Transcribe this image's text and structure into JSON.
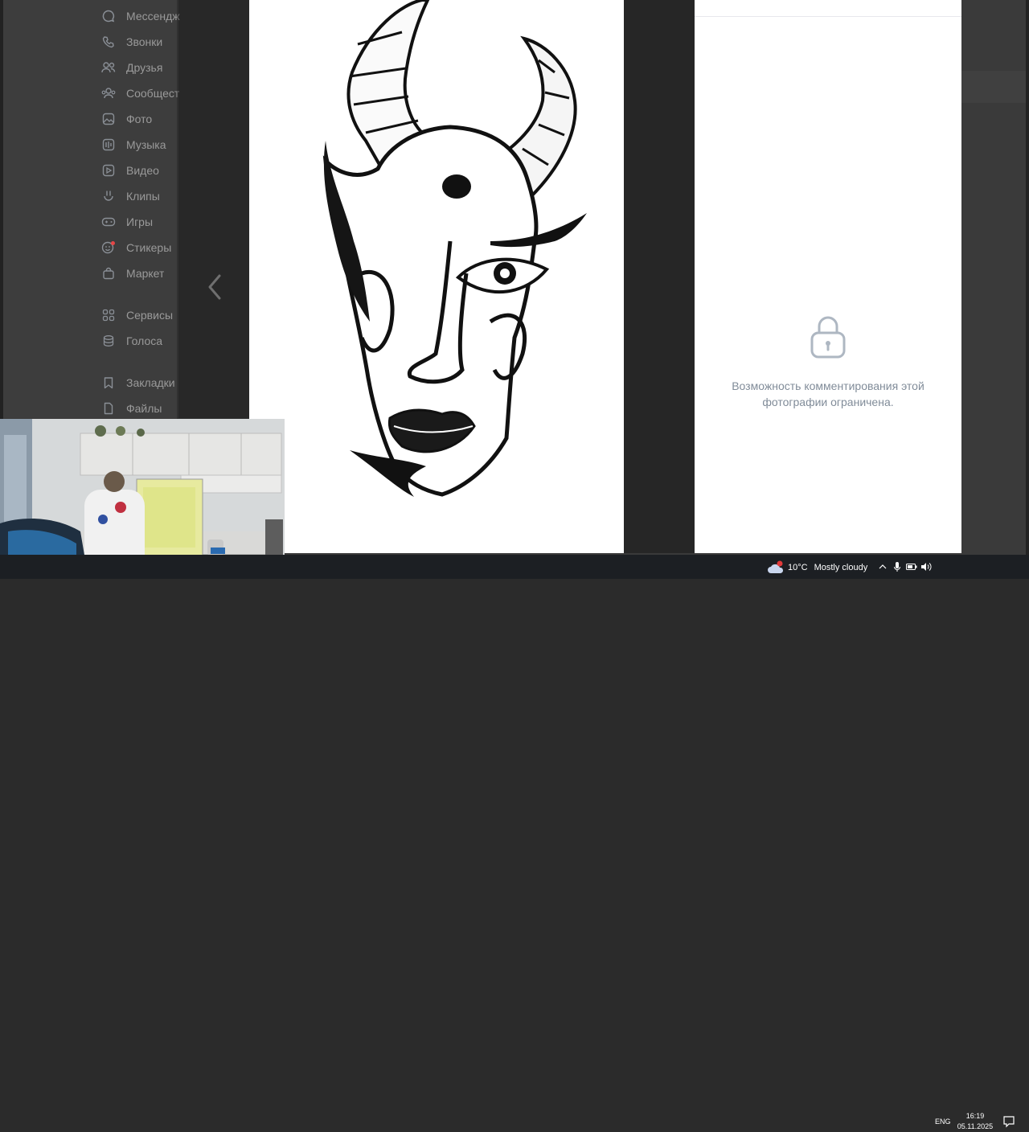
{
  "sidebar": {
    "items": [
      {
        "label": "Мессендж",
        "icon": "messenger-icon"
      },
      {
        "label": "Звонки",
        "icon": "phone-icon"
      },
      {
        "label": "Друзья",
        "icon": "friends-icon"
      },
      {
        "label": "Сообщест",
        "icon": "communities-icon"
      },
      {
        "label": "Фото",
        "icon": "photo-icon"
      },
      {
        "label": "Музыка",
        "icon": "music-icon"
      },
      {
        "label": "Видео",
        "icon": "video-icon"
      },
      {
        "label": "Клипы",
        "icon": "clips-icon"
      },
      {
        "label": "Игры",
        "icon": "games-icon"
      },
      {
        "label": "Стикеры",
        "icon": "stickers-icon"
      },
      {
        "label": "Маркет",
        "icon": "market-icon"
      },
      {
        "label": "Сервисы",
        "icon": "services-icon"
      },
      {
        "label": "Голоса",
        "icon": "votes-icon"
      },
      {
        "label": "Закладки",
        "icon": "bookmarks-icon"
      },
      {
        "label": "Файлы",
        "icon": "files-icon"
      }
    ]
  },
  "viewer": {
    "prev_icon": "chevron-left-icon",
    "next_icon": "chevron-right-icon",
    "photo": "ink-drawing-demon-mask"
  },
  "comments": {
    "locked_message": "Возможность комментирования этой фотографии ограничена.",
    "icon": "lock-icon"
  },
  "taskbar": {
    "weather_temp": "10°C",
    "weather_desc": "Mostly cloudy",
    "language": "ENG",
    "time": "16:19",
    "date": "05.11.2025"
  },
  "colors": {
    "panel_bg": "#ffffff",
    "muted_text": "#818c99",
    "taskbar_bg": "#1c1f23"
  }
}
